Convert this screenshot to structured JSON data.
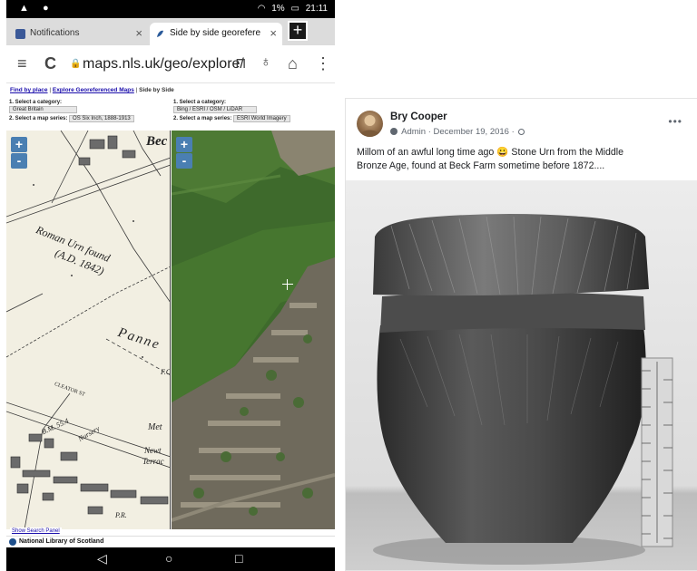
{
  "phone": {
    "status": {
      "left_icons": "▲ ●",
      "battery": "1%",
      "time": "21:11"
    },
    "tabs": [
      {
        "title": "Notifications",
        "close": "×"
      },
      {
        "title": "Side by side georeferenced m",
        "close": "×"
      }
    ],
    "new_tab": "+",
    "toolbar": {
      "menu_icon": "≡",
      "reload_icon": "C",
      "url": "maps.nls.uk/geo/explore/",
      "bookmark_icon": "⊓",
      "mic_icon": "♁",
      "home_icon": "⌂",
      "overflow_icon": "⋮"
    },
    "page": {
      "nav": {
        "find": "Find by place",
        "sep1": " | ",
        "explore": "Explore Georeferenced Maps",
        "sep2": " | ",
        "current": "Side by Side"
      },
      "left_select": {
        "category_label": "1. Select a category:",
        "category_value": "Great Britain",
        "series_label": "2. Select a map series:",
        "series_value": "OS Six Inch, 1888-1913"
      },
      "right_select": {
        "category_label": "1. Select a category:",
        "category_value": "Bing / ESRI / OSM / LiDAR",
        "series_label": "2. Select a map series:",
        "series_value": "ESRI World Imagery"
      },
      "zoom_in": "+",
      "zoom_out": "-",
      "map_labels": {
        "roman_urn": "Roman Urn found",
        "ad": "(A.D. 1842)",
        "panne": "Panne",
        "beck": "Bec",
        "cleator": "CLEATOR ST",
        "newton": "Newt",
        "terrace": "Terrac",
        "met": "Met",
        "nursery": "Nursery",
        "bm": "B.M. 55.4",
        "pr": "P.R.",
        "fo": "F.O"
      },
      "show_search": "Show Search Panel",
      "footer": "National Library of Scotland"
    },
    "nav_buttons": {
      "back": "◁",
      "home": "○",
      "recents": "□"
    }
  },
  "post": {
    "author": "Bry Cooper",
    "role": "Admin",
    "date": "December 19, 2016",
    "more": "•••",
    "text_line1": "Millom of an awful long time ago 😀 Stone Urn from the Middle",
    "text_line2": "Bronze Age, found at Beck Farm sometime before 1872...."
  }
}
